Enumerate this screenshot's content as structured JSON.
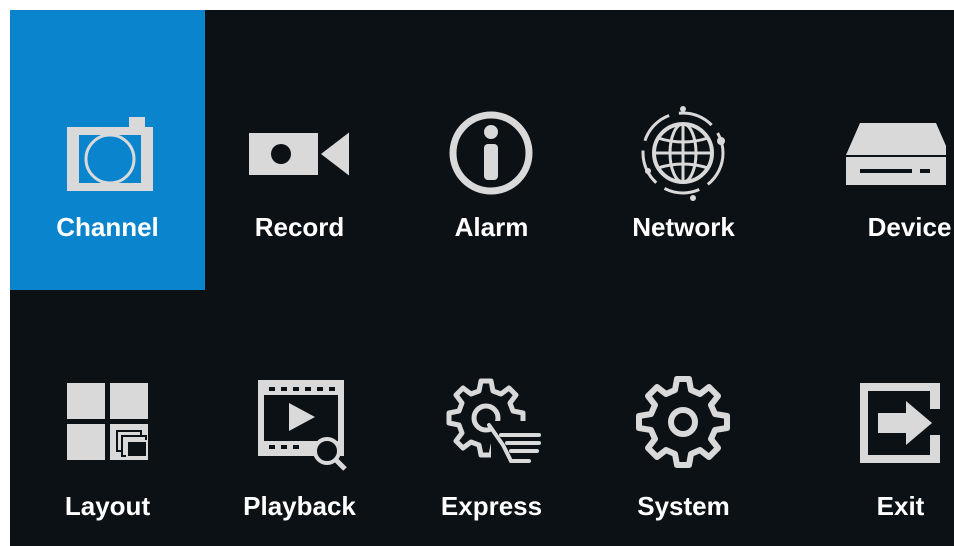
{
  "menu": {
    "items": [
      {
        "id": "channel",
        "label": "Channel",
        "icon": "camera-icon",
        "selected": true
      },
      {
        "id": "record",
        "label": "Record",
        "icon": "video-camera-icon",
        "selected": false
      },
      {
        "id": "alarm",
        "label": "Alarm",
        "icon": "info-icon",
        "selected": false
      },
      {
        "id": "network",
        "label": "Network",
        "icon": "globe-icon",
        "selected": false
      },
      {
        "id": "device",
        "label": "Device",
        "icon": "hard-drive-icon",
        "selected": false
      },
      {
        "id": "layout",
        "label": "Layout",
        "icon": "grid-layout-icon",
        "selected": false
      },
      {
        "id": "playback",
        "label": "Playback",
        "icon": "playback-search-icon",
        "selected": false
      },
      {
        "id": "express",
        "label": "Express",
        "icon": "gear-hand-icon",
        "selected": false
      },
      {
        "id": "system",
        "label": "System",
        "icon": "gear-icon",
        "selected": false
      },
      {
        "id": "exit",
        "label": "Exit",
        "icon": "exit-icon",
        "selected": false
      }
    ]
  },
  "colors": {
    "background": "#0c1116",
    "selected": "#0a84cd",
    "icon": "#d9d9d9",
    "label": "#ffffff"
  }
}
